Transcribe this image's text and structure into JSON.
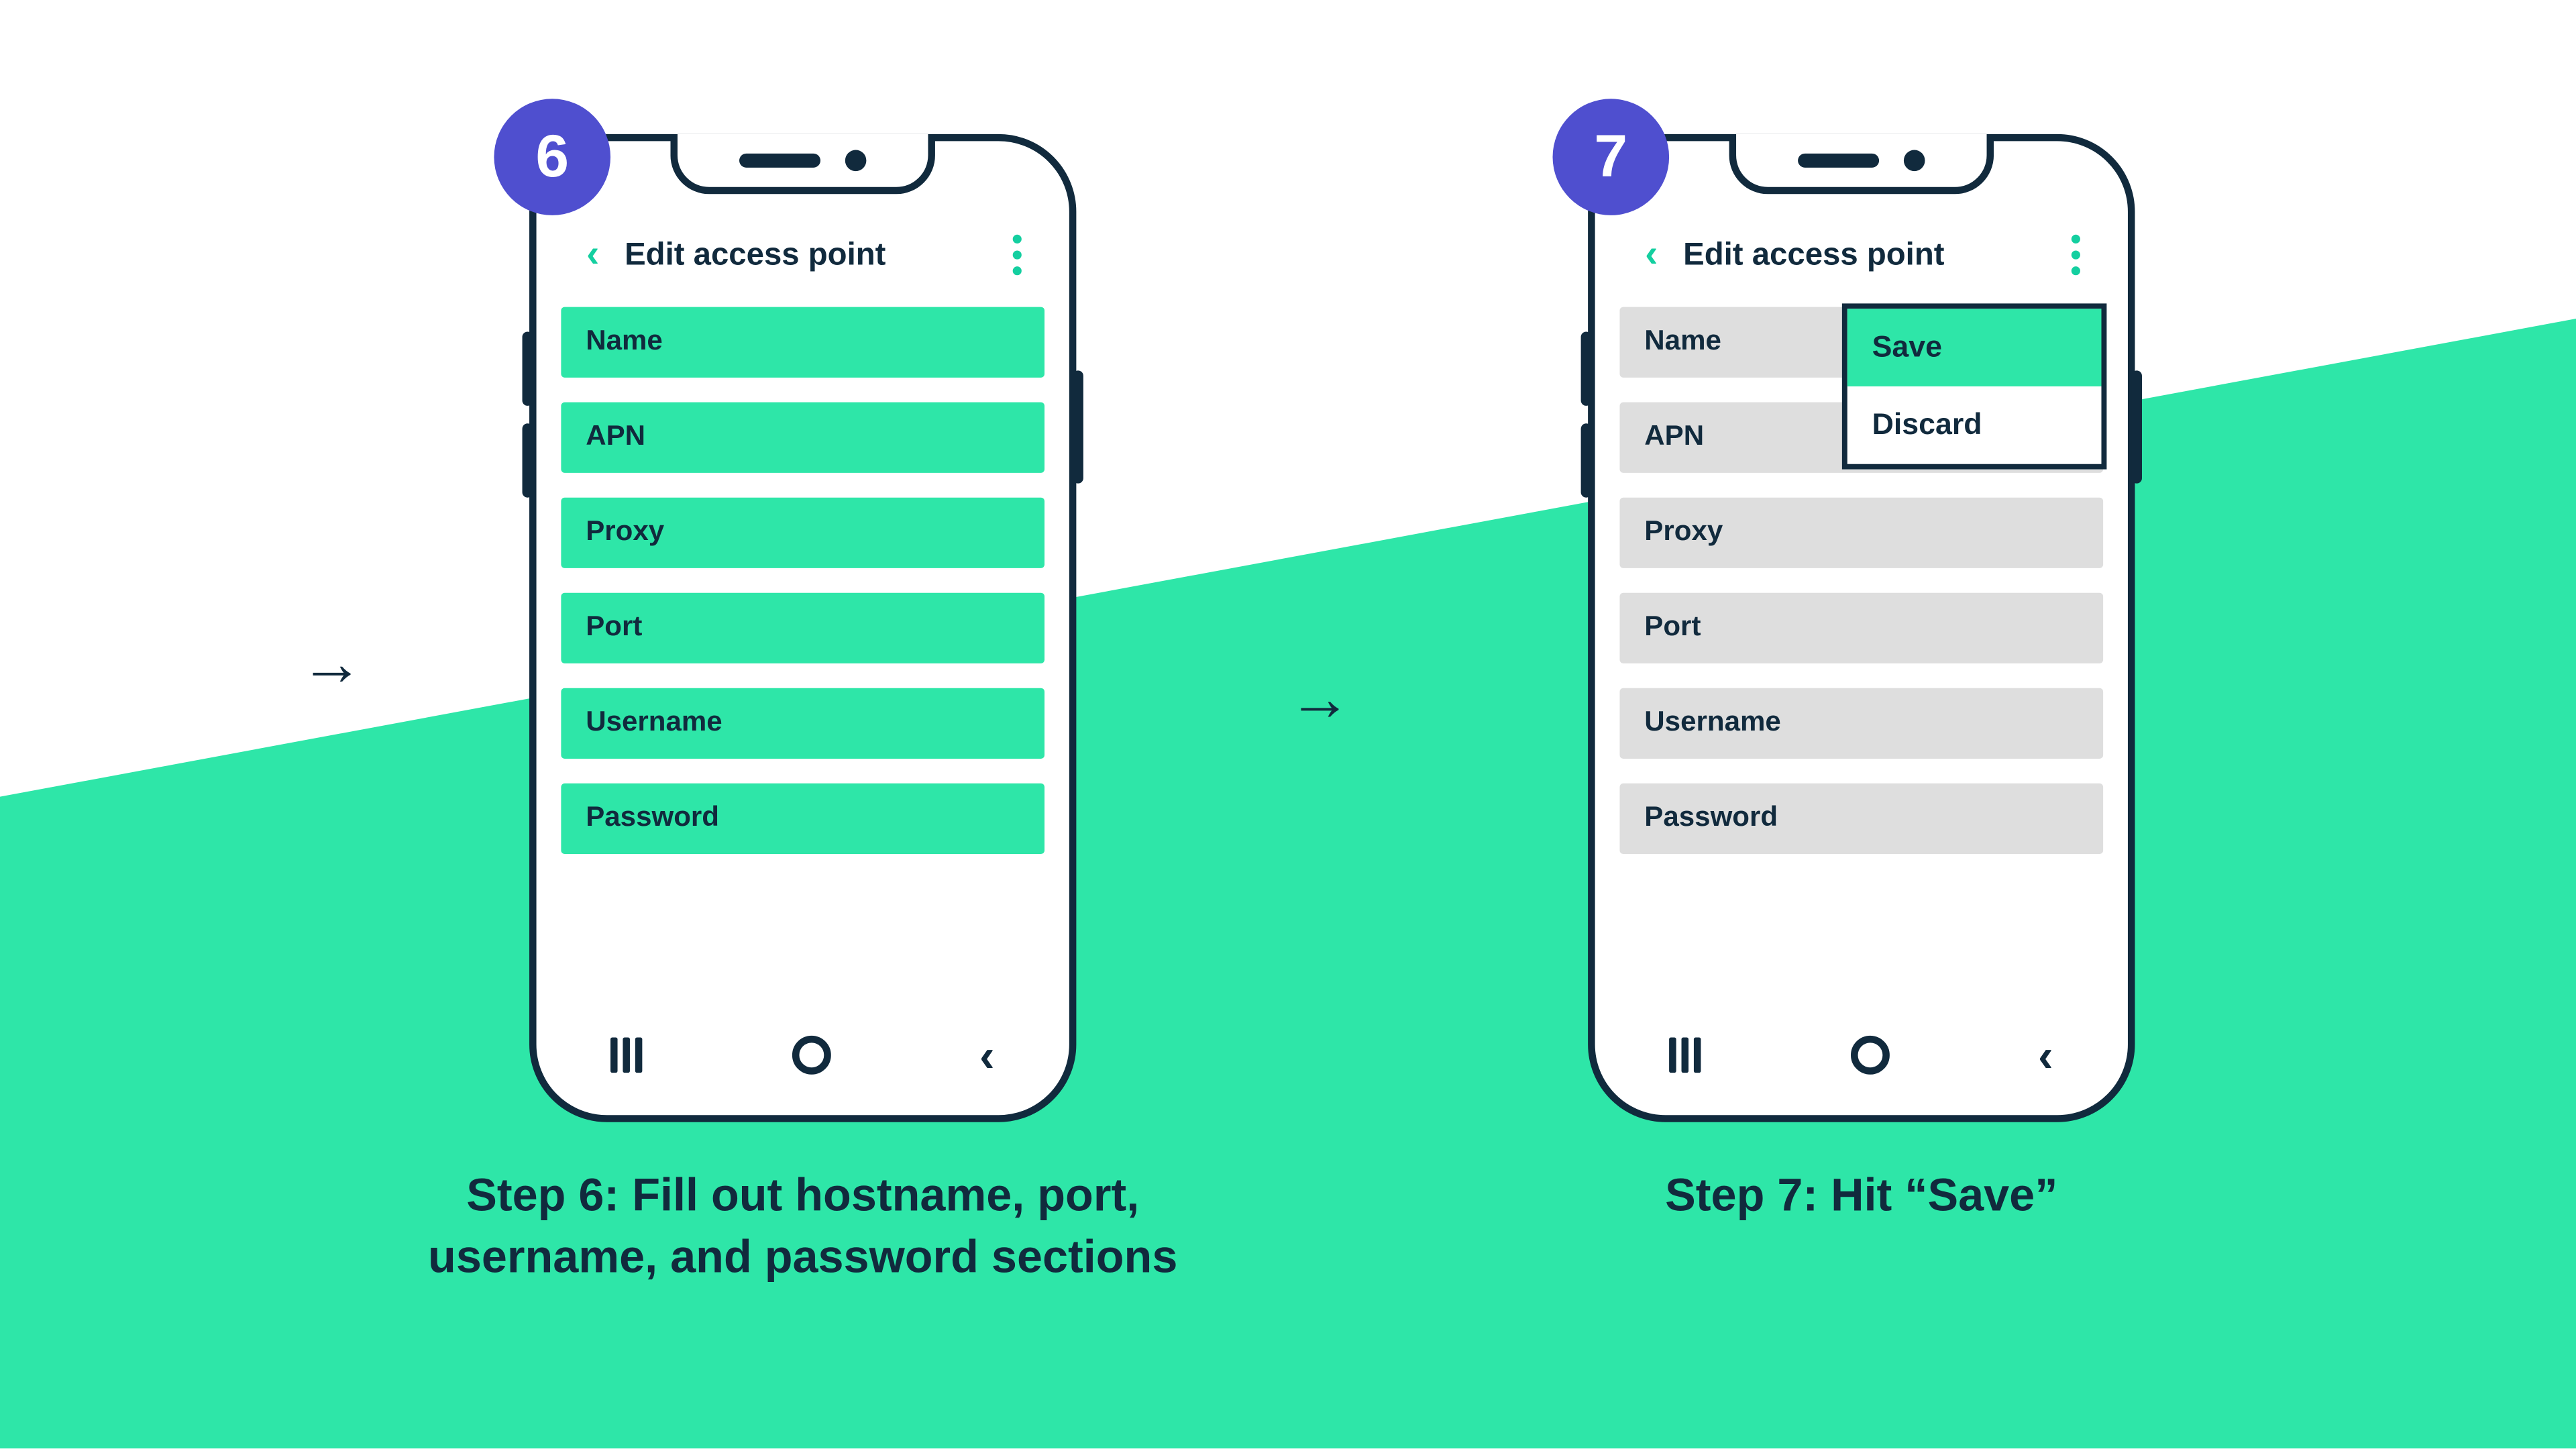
{
  "colors": {
    "accent": "#2ee6a8",
    "badge": "#4f4fcf",
    "ink": "#112a3d"
  },
  "screen_title": "Edit access point",
  "fields": {
    "name": "Name",
    "apn": "APN",
    "proxy": "Proxy",
    "port": "Port",
    "username": "Username",
    "password": "Password"
  },
  "menu": {
    "save": "Save",
    "discard": "Discard"
  },
  "step6": {
    "num": "6",
    "caption_line1": "Step 6: Fill out hostname, port,",
    "caption_line2": "username, and password sections"
  },
  "step7": {
    "num": "7",
    "caption": "Step 7: Hit “Save”"
  }
}
